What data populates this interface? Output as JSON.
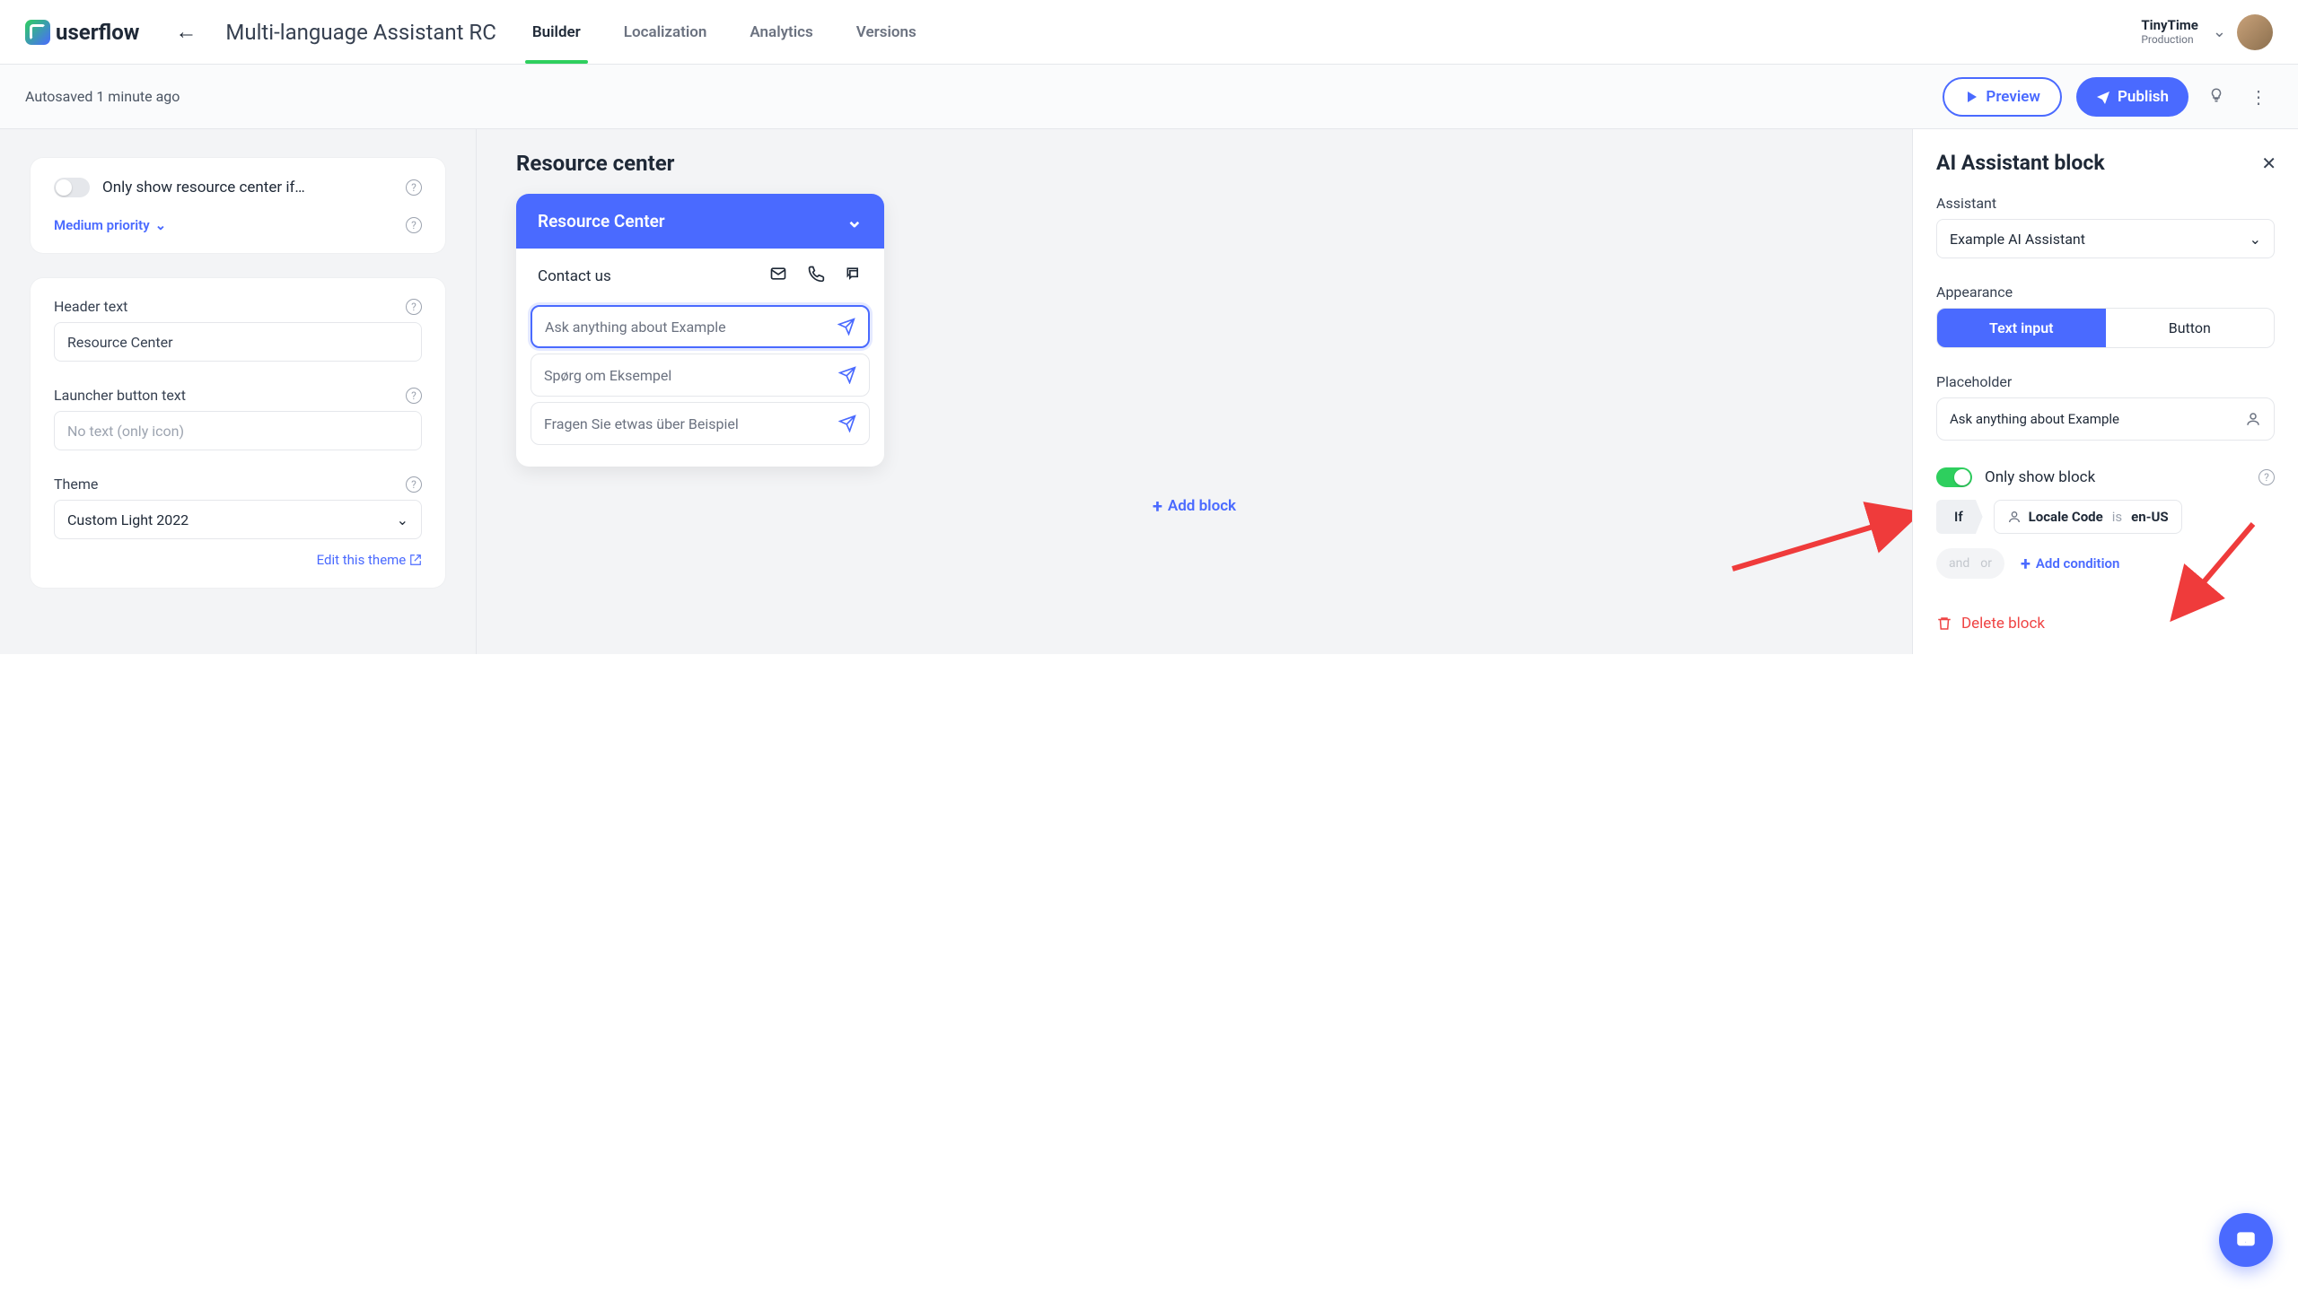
{
  "app": {
    "name": "userflow"
  },
  "header": {
    "title": "Multi-language Assistant RC",
    "tabs": [
      "Builder",
      "Localization",
      "Analytics",
      "Versions"
    ],
    "activeTab": 0,
    "workspace": {
      "name": "TinyTime",
      "env": "Production"
    }
  },
  "subbar": {
    "autosave": "Autosaved 1 minute ago",
    "preview": "Preview",
    "publish": "Publish"
  },
  "left": {
    "showIfLabel": "Only show resource center if…",
    "priority": "Medium priority",
    "headerTextLabel": "Header text",
    "headerTextValue": "Resource Center",
    "launcherLabel": "Launcher button text",
    "launcherPlaceholder": "No text (only icon)",
    "themeLabel": "Theme",
    "themeValue": "Custom Light 2022",
    "editTheme": "Edit this theme"
  },
  "center": {
    "heading": "Resource center",
    "cardTitle": "Resource Center",
    "contact": "Contact us",
    "asks": [
      "Ask anything about Example",
      "Spørg om Eksempel",
      "Fragen Sie etwas über Beispiel"
    ],
    "addBlock": "Add block"
  },
  "right": {
    "heading": "AI Assistant block",
    "assistantLabel": "Assistant",
    "assistantValue": "Example AI Assistant",
    "appearanceLabel": "Appearance",
    "appearanceOptions": [
      "Text input",
      "Button"
    ],
    "placeholderLabel": "Placeholder",
    "placeholderValue": "Ask anything about Example",
    "onlyShowLabel": "Only show block",
    "condIf": "If",
    "condAttr": "Locale Code",
    "condOp": "is",
    "condVal": "en-US",
    "and": "and",
    "or": "or",
    "addCondition": "Add condition",
    "delete": "Delete block"
  }
}
